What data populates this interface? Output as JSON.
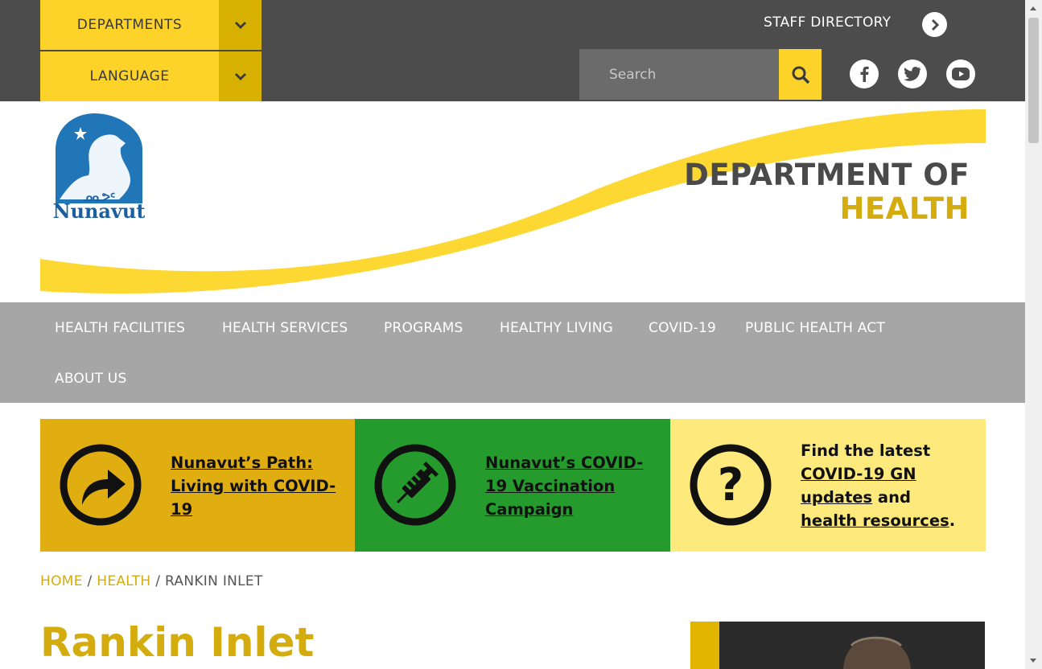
{
  "topbar": {
    "departments_label": "DEPARTMENTS",
    "language_label": "LANGUAGE",
    "staff_directory_label": "STAFF DIRECTORY",
    "search_placeholder": "Search"
  },
  "header": {
    "logo_text": "Nunavut",
    "title_line1": "DEPARTMENT OF",
    "title_line2": "HEALTH"
  },
  "nav": {
    "items": [
      "HEALTH FACILITIES",
      "HEALTH SERVICES",
      "PROGRAMS",
      "HEALTHY LIVING",
      "COVID-19",
      "PUBLIC HEALTH ACT",
      "ABOUT US"
    ]
  },
  "promos": {
    "path_link": "Nunavut’s Path: Living with COVID-19",
    "vaccination_link": "Nunavut’s COVID-19 Vaccination Campaign",
    "latest_prefix": "Find the latest",
    "latest_link1": "COVID-19 GN updates",
    "latest_and": "and",
    "latest_link2": "health resources",
    "latest_period": "."
  },
  "breadcrumb": {
    "home": "HOME",
    "health": "HEALTH",
    "sep": "/",
    "current": "RANKIN INLET"
  },
  "page": {
    "title": "Rankin Inlet"
  },
  "colors": {
    "yellow": "#fdd32a",
    "gold": "#d4ac0d",
    "green": "#259b2e",
    "topbar": "#4c4c4c",
    "nav": "#a6a6a6"
  }
}
